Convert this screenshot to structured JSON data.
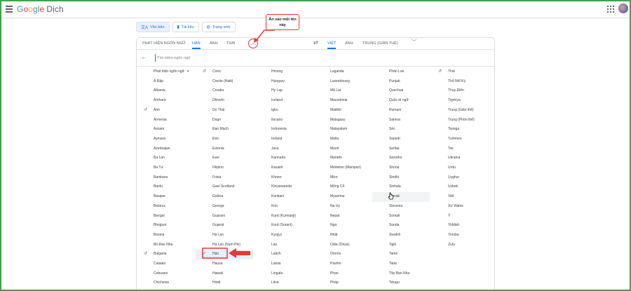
{
  "header": {
    "logo_parts": [
      "G",
      "o",
      "o",
      "g",
      "l",
      "e"
    ],
    "product": "Dịch"
  },
  "mode_tabs": [
    {
      "label": "Văn bản",
      "icon": "translate-icon"
    },
    {
      "label": "Tài liệu",
      "icon": "document-icon"
    },
    {
      "label": "Trang web",
      "icon": "globe-icon"
    }
  ],
  "source_tabs": [
    "PHÁT HIỆN NGÔN NGỮ",
    "HÀN",
    "ANH",
    "THÁI"
  ],
  "target_tabs": [
    "VIỆT",
    "ANH",
    "TRUNG (GIẢN THỂ)"
  ],
  "search": {
    "placeholder": "Tìm kiếm ngôn ngữ"
  },
  "annotation": {
    "callout_text": "Ấn vào mũi tên này"
  },
  "colors": {
    "accent": "#1a73e8",
    "annotation_red": "#e53935",
    "frame_green": "#3fa34d"
  },
  "languages": [
    [
      "Phát hiện ngôn ngữ",
      "Á Rập",
      "Albania",
      "Amharic",
      "Anh",
      "Armenia",
      "Assam",
      "Aymara",
      "Azerbaijan",
      "Ba Lan",
      "Ba Tư",
      "Bambara",
      "Bantu",
      "Basque",
      "Belarus",
      "Bengal",
      "Bhojpuri",
      "Bosnia",
      "Bồ Đào Nha",
      "Bulgaria",
      "Catalan",
      "Cebuano",
      "Chichewa"
    ],
    [
      "Corsi",
      "Creole (Haiti)",
      "Croatia",
      "Dhivehi",
      "Do Thái",
      "Dogri",
      "Đan Mạch",
      "Đức",
      "Estonia",
      "Ewe",
      "Filipino",
      "Frisia",
      "Gael Scotland",
      "Galicia",
      "George",
      "Guarani",
      "Gujarat",
      "Hà Lan",
      "Hà Lan (Nam Phi)",
      "Hàn",
      "Hausa",
      "Hawaii",
      "Hindi"
    ],
    [
      "Hmong",
      "Hungary",
      "Hy Lạp",
      "Iceland",
      "Igbo",
      "Ilocano",
      "Indonesia",
      "Ireland",
      "Java",
      "Kannada",
      "Kazakh",
      "Khmer",
      "Kinyarwanda",
      "Konkani",
      "Krio",
      "Kurd (Kurmanji)",
      "Kurd (Sorani)",
      "Kyrgyz",
      "Lào",
      "Latinh",
      "Latvia",
      "Lingala",
      "Litva"
    ],
    [
      "Luganda",
      "Luxembourg",
      "Mã Lai",
      "Macedonia",
      "Maithili",
      "Malagasy",
      "Malayalam",
      "Malta",
      "Maori",
      "Marathi",
      "Meiteilon (Manipuri)",
      "Mizo",
      "Mông Cổ",
      "Myanmar",
      "Na Uy",
      "Nepal",
      "Nga",
      "Nhật",
      "Odia (Oriya)",
      "Oromo",
      "Pashto",
      "Phan",
      "Pháp"
    ],
    [
      "Phần Lan",
      "Punjab",
      "Quechua",
      "Quốc tế ngữ",
      "Rumani",
      "Samoa",
      "Séc",
      "Sepedi",
      "Serbia",
      "Sesotho",
      "Shona",
      "Sindhi",
      "Sinhala",
      "Slovak",
      "Slovenia",
      "Somali",
      "Sunda",
      "Swahili",
      "Tajik",
      "Tamil",
      "Tatar",
      "Tây Ban Nha",
      "Telugu"
    ],
    [
      "Thái",
      "Thổ Nhĩ Kỳ",
      "Thụy Điển",
      "Tigrinya",
      "Trung (Giản thể)",
      "Trung (Phồn thể)",
      "Tsonga",
      "Turkmen",
      "Twi",
      "Ukraina",
      "Urdu",
      "Uyghur",
      "Uzbek",
      "Việt",
      "Xứ Wales",
      "Ý",
      "Yiddish",
      "Yoruba",
      "Zulu"
    ]
  ],
  "recent_languages": [
    "Corsi",
    "Anh",
    "Bulgaria",
    "Thái"
  ],
  "selected_language": "Hàn",
  "hovered_language": "Slovak"
}
